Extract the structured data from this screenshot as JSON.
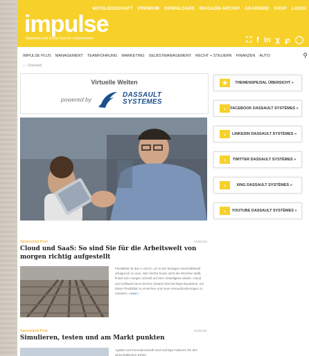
{
  "topnav": [
    "MITGLIEDSCHAFT",
    "PREMIUM",
    "DOWNLOADS",
    "MAGAZIN-ARCHIV",
    "AKADEMIE",
    "SHOP",
    "LOGIN"
  ],
  "logo": "impulse",
  "tagline": "Netzwerk und Know-how für Unternehmer",
  "social_icons": [
    "shop-bag-icon",
    "facebook-icon",
    "linkedin-icon",
    "xing-icon",
    "pinterest-icon",
    "instagram-icon"
  ],
  "mainnav": [
    "IMPULSE PLUS",
    "MANAGEMENT",
    "TEAMFÜHRUNG",
    "MARKETING",
    "SELBSTMANAGEMENT",
    "RECHT + STEUERN",
    "FINANZEN",
    "AUTO"
  ],
  "breadcrumb": "Dassault",
  "banner": {
    "title": "Virtuelle Welten",
    "powered": "powered by",
    "brand_line1": "DASSAULT",
    "brand_line2": "SYSTEMES"
  },
  "sidebar": [
    {
      "label": "THEMENSPEZIAL ÜBERSICHT »",
      "icon": "star-icon"
    },
    {
      "label": "FACEBOOK DASSAULT SYSTÈMES »",
      "icon": "chevron-right-icon"
    },
    {
      "label": "LINKEDIN DASSAULT SYSTÈMES »",
      "icon": "chevron-right-icon"
    },
    {
      "label": "TWITTER DASSAULT SYSTÈMES »",
      "icon": "chevron-right-icon"
    },
    {
      "label": "XING DASSAULT SYSTÈMES »",
      "icon": "chevron-right-icon"
    },
    {
      "label": "YOUTUBE DASSAULT SYSTÈMES »",
      "icon": "chevron-right-icon"
    }
  ],
  "articles": [
    {
      "label": "Sponsored Post",
      "advert": "ANZEIGE",
      "title": "Cloud und SaaS: So sind Sie für die Arbeitswelt von morgen richtig aufgestellt",
      "teaser": "Flexibilität ist das A und O, um in der heutigen Geschäftswelt erfolgreich zu sein. Wer hierfür heute nicht die Weichen stellt, findet sich morgen schnell auf dem Abstellgleis wieder. Cloud und Software-as-a-Service (SaaS) sind wichtige Bausteine, um diese Flexibilität zu erreichen und neue Herausforderungen zu meistern.",
      "more": "Lesen ›"
    },
    {
      "label": "Sponsored Post",
      "advert": "ANZEIGE",
      "title": "Simulieren, testen und am Markt punkten",
      "teaser": "Agilität und Innovationskraft sind wichtige Faktoren für den wirtschaftlichen Erfolg"
    }
  ],
  "colors": {
    "brand": "#f7d12a",
    "label": "#f0a10a"
  }
}
